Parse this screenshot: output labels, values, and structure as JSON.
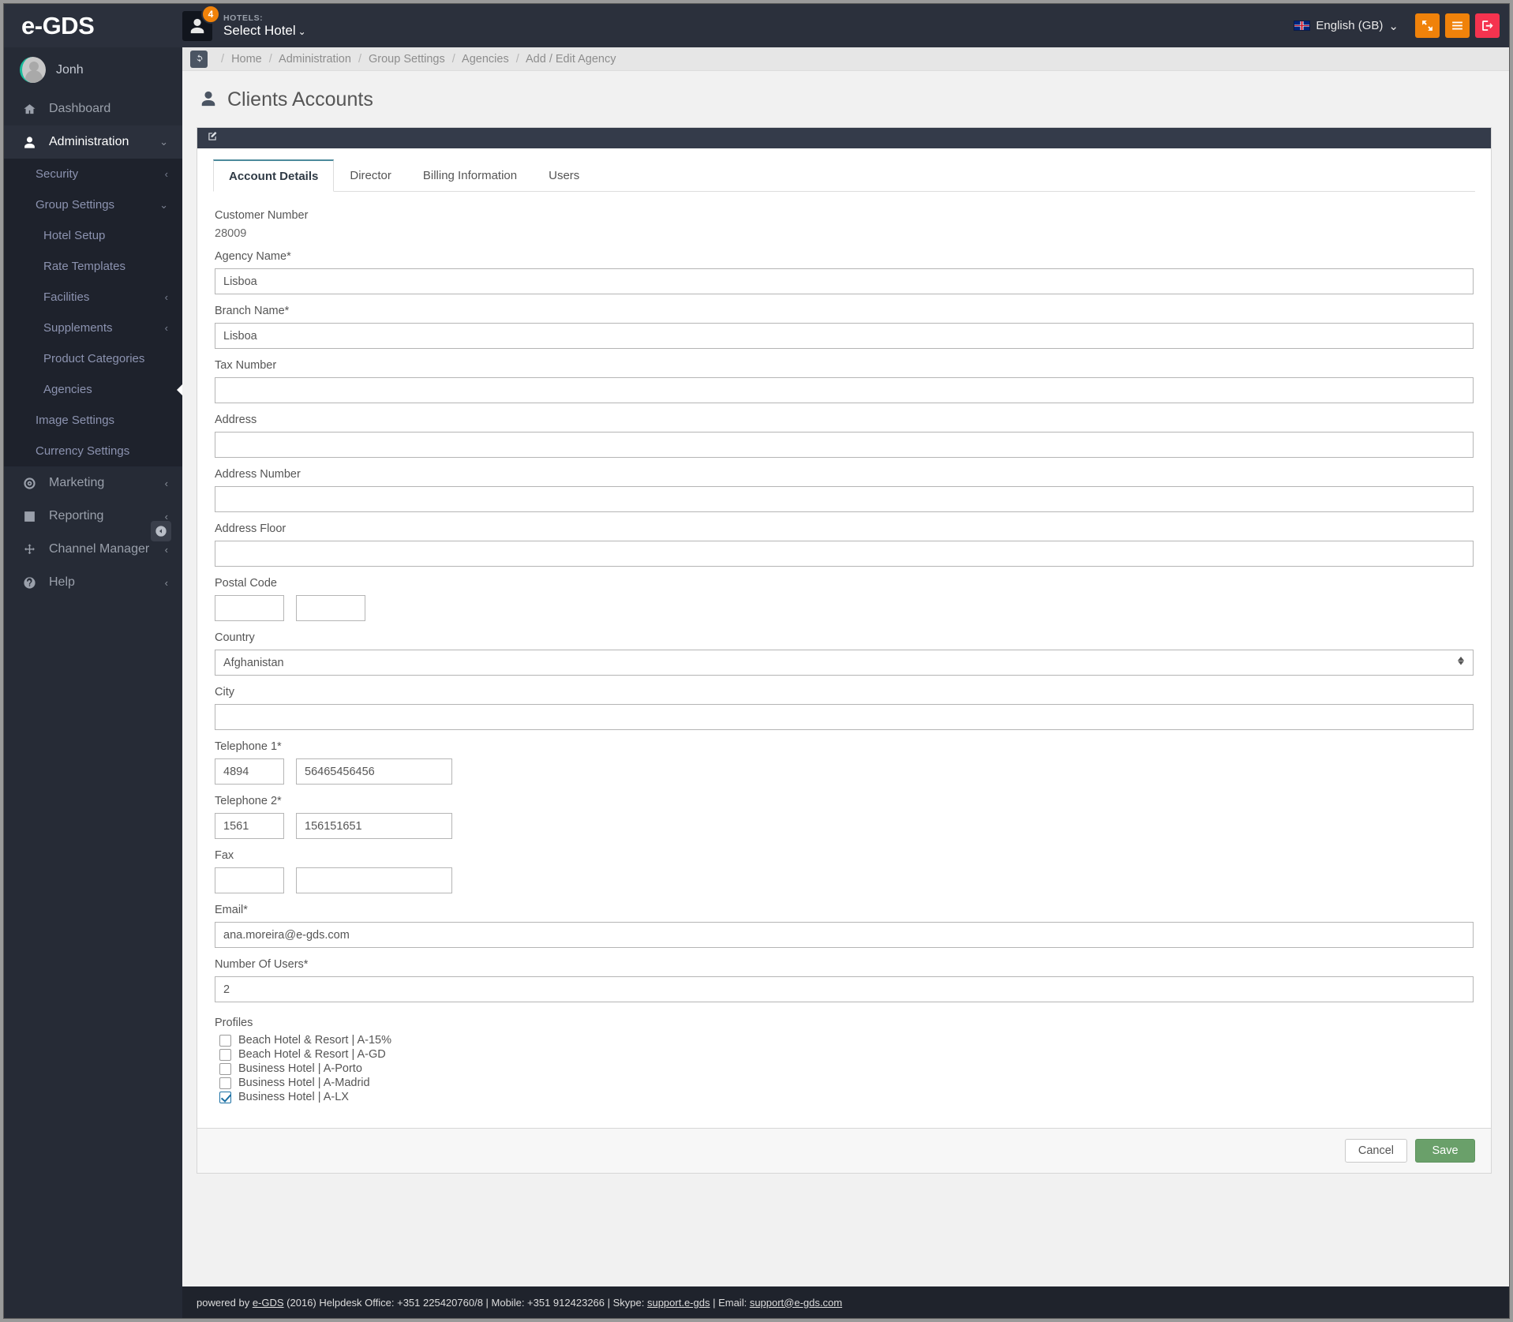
{
  "topbar": {
    "brand": "e-GDS",
    "notification_count": "4",
    "hotels_label": "HOTELS:",
    "hotel_select": "Select Hotel",
    "caret": "⌄",
    "language": "English (GB)",
    "lang_caret": "⌄",
    "icons": {
      "expand": "expand-icon",
      "menu": "hamburger-menu-icon",
      "logout": "logout-icon"
    },
    "accent_orange": "#f0820a",
    "accent_red": "#f5334f",
    "bar_bg": "#2b303c"
  },
  "sidebar": {
    "user": "Jonh",
    "items": [
      {
        "label": "Dashboard",
        "icon": "home-icon",
        "chev": "",
        "active": false
      },
      {
        "label": "Administration",
        "icon": "user-icon",
        "chev": "⌄",
        "active": true
      },
      {
        "label": "Marketing",
        "icon": "target-icon",
        "chev": "‹",
        "active": false
      },
      {
        "label": "Reporting",
        "icon": "bar-chart-icon",
        "chev": "‹",
        "active": false
      },
      {
        "label": "Channel Manager",
        "icon": "move-arrows-icon",
        "chev": "‹",
        "active": false
      },
      {
        "label": "Help",
        "icon": "question-circle-icon",
        "chev": "‹",
        "active": false
      }
    ],
    "admin_sub": [
      {
        "label": "Security",
        "chev": "‹",
        "level": 1,
        "selected": false
      },
      {
        "label": "Group Settings",
        "chev": "⌄",
        "level": 1,
        "selected": false
      },
      {
        "label": "Hotel Setup",
        "chev": "",
        "level": 2,
        "selected": false
      },
      {
        "label": "Rate Templates",
        "chev": "",
        "level": 2,
        "selected": false
      },
      {
        "label": "Facilities",
        "chev": "‹",
        "level": 2,
        "selected": false
      },
      {
        "label": "Supplements",
        "chev": "‹",
        "level": 2,
        "selected": false
      },
      {
        "label": "Product Categories",
        "chev": "",
        "level": 2,
        "selected": false
      },
      {
        "label": "Agencies",
        "chev": "",
        "level": 2,
        "selected": true
      },
      {
        "label": "Image Settings",
        "chev": "",
        "level": 1,
        "selected": false
      },
      {
        "label": "Currency Settings",
        "chev": "",
        "level": 1,
        "selected": false
      }
    ],
    "collapse_icon": "collapse-left-icon"
  },
  "breadcrumb": {
    "refresh_icon": "refresh-icon",
    "items": [
      "Home",
      "Administration",
      "Group Settings",
      "Agencies",
      "Add / Edit Agency"
    ],
    "separator": "/"
  },
  "page": {
    "title": "Clients Accounts",
    "title_icon": "user-icon",
    "panel_icon": "edit-pencil-icon"
  },
  "tabs": [
    {
      "label": "Account Details",
      "active": true
    },
    {
      "label": "Director",
      "active": false
    },
    {
      "label": "Billing Information",
      "active": false
    },
    {
      "label": "Users",
      "active": false
    }
  ],
  "form": {
    "customer_number_label": "Customer Number",
    "customer_number_value": "28009",
    "agency_name_label": "Agency Name*",
    "agency_name_value": "Lisboa",
    "branch_name_label": "Branch Name*",
    "branch_name_value": "Lisboa",
    "tax_number_label": "Tax Number",
    "tax_number_value": "",
    "address_label": "Address",
    "address_value": "",
    "address_number_label": "Address Number",
    "address_number_value": "",
    "address_floor_label": "Address Floor",
    "address_floor_value": "",
    "postal_code_label": "Postal Code",
    "postal_code_value_1": "",
    "postal_code_value_2": "",
    "country_label": "Country",
    "country_value": "Afghanistan",
    "city_label": "City",
    "city_value": "",
    "telephone1_label": "Telephone 1*",
    "telephone1_prefix": "4894",
    "telephone1_number": "56465456456",
    "telephone2_label": "Telephone 2*",
    "telephone2_prefix": "1561",
    "telephone2_number": "156151651",
    "fax_label": "Fax",
    "fax_prefix": "",
    "fax_number": "",
    "email_label": "Email*",
    "email_value": "ana.moreira@e-gds.com",
    "number_of_users_label": "Number Of Users*",
    "number_of_users_value": "2",
    "profiles_label": "Profiles",
    "profiles": [
      {
        "label": "Beach Hotel & Resort | A-15%",
        "checked": false
      },
      {
        "label": "Beach Hotel & Resort | A-GD",
        "checked": false
      },
      {
        "label": "Business Hotel | A-Porto",
        "checked": false
      },
      {
        "label": "Business Hotel | A-Madrid",
        "checked": false
      },
      {
        "label": "Business Hotel | A-LX",
        "checked": true
      }
    ]
  },
  "actions": {
    "cancel": "Cancel",
    "save": "Save",
    "save_color": "#6aa06a"
  },
  "footer": {
    "prefix": "powered by ",
    "brand": "e-GDS",
    "text1": " (2016) Helpdesk Office: +351 225420760/8 | Mobile: +351 912423266 | Skype: ",
    "skype": "support.e-gds",
    "text2": " | Email: ",
    "email": "support@e-gds.com"
  }
}
